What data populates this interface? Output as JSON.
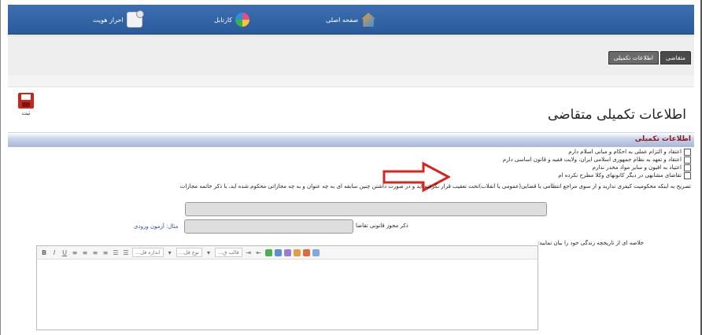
{
  "nav": {
    "home": "صفحه اصلی",
    "cartable": "کارتابل",
    "auth": "احراز هویت"
  },
  "tabs": [
    "متقاضی",
    "اطلاعات تکمیلی"
  ],
  "save": {
    "label": "ثبت"
  },
  "page": {
    "title": "اطلاعات تکمیلی متقاضی"
  },
  "section": {
    "title": "اطلاعات تکمیلی"
  },
  "checkboxes": [
    "اعتقاد و التزام عملی به احکام و مبانی اسلام دارم",
    "اعتقاد و تعهد به نظام جمهوری اسلامی ایران، ولایت فقیه و قانون اساسی دارم",
    "اعتیاد به افیون و سایر مواد مخدر ندارم",
    "تقاضای مشابهی در دیگر کانونهای وکلا مطرح نکرده ام"
  ],
  "explain": "تصریح به اینکه محکومیت کیفری ندارید و از سوی مراجع انتظامی یا قضایی(عمومی یا انقلاب)تحت تعقیب قرار نگرفته اید و در صورت داشتن چنین سابقه ای به چه عنوان و به چه مجازاتی محکوم شده اید، با ذکر خاتمه مجازات",
  "license": {
    "label": "ذکر مجوز قانونی تقاضا",
    "example": "مثال: آزمون ورودی"
  },
  "bio": {
    "label": "خلاصه ای از تاریخچه زندگی خود را بیان نمایید:"
  },
  "toolbar": {
    "style": "قالب ق...",
    "font": "نوع قل...",
    "size": "اندازه قل..."
  },
  "colors": {
    "nav_bg": "#2f62a6",
    "section_text": "#8b1a1a",
    "arrow": "#d6241e"
  }
}
